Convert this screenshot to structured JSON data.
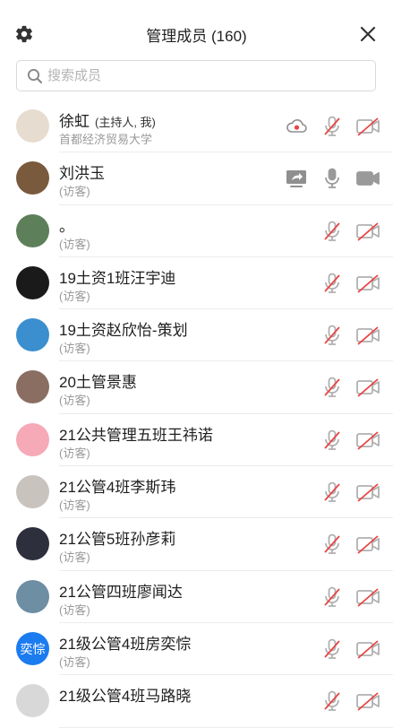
{
  "header": {
    "title": "管理成员 (160)"
  },
  "search": {
    "placeholder": "搜索成员"
  },
  "members": [
    {
      "name": "徐虹",
      "role": "(主持人, 我)",
      "org": "首都经济贸易大学",
      "avatar_color": "#e7dcd0",
      "avatar_text": "",
      "status_icon": "cloud-icon",
      "mic": "muted",
      "video": "off"
    },
    {
      "name": "刘洪玉",
      "role": "",
      "org": "(访客)",
      "avatar_color": "#7a5a3c",
      "avatar_text": "",
      "status_icon": "screen-share-icon",
      "mic": "on",
      "video": "on"
    },
    {
      "name": "。",
      "role": "",
      "org": "(访客)",
      "avatar_color": "#5d7f5a",
      "avatar_text": "",
      "status_icon": "",
      "mic": "muted",
      "video": "off"
    },
    {
      "name": "19土资1班汪宇迪",
      "role": "",
      "org": "(访客)",
      "avatar_color": "#1a1a1a",
      "avatar_text": "",
      "status_icon": "",
      "mic": "muted",
      "video": "off"
    },
    {
      "name": "19土资赵欣怡-策划",
      "role": "",
      "org": "(访客)",
      "avatar_color": "#3b8fcf",
      "avatar_text": "",
      "status_icon": "",
      "mic": "muted",
      "video": "off"
    },
    {
      "name": "20土管景惠",
      "role": "",
      "org": "(访客)",
      "avatar_color": "#8a6e62",
      "avatar_text": "",
      "status_icon": "",
      "mic": "muted",
      "video": "off"
    },
    {
      "name": "21公共管理五班王祎诺",
      "role": "",
      "org": "(访客)",
      "avatar_color": "#f6a9b7",
      "avatar_text": "",
      "status_icon": "",
      "mic": "muted",
      "video": "off"
    },
    {
      "name": "21公管4班李斯玮",
      "role": "",
      "org": "(访客)",
      "avatar_color": "#c9c3bd",
      "avatar_text": "",
      "status_icon": "",
      "mic": "muted",
      "video": "off"
    },
    {
      "name": "21公管5班孙彦莉",
      "role": "",
      "org": "(访客)",
      "avatar_color": "#2e2f3d",
      "avatar_text": "",
      "status_icon": "",
      "mic": "muted",
      "video": "off"
    },
    {
      "name": "21公管四班廖闻达",
      "role": "",
      "org": "(访客)",
      "avatar_color": "#6d8ea3",
      "avatar_text": "",
      "status_icon": "",
      "mic": "muted",
      "video": "off"
    },
    {
      "name": "21级公管4班房奕悰",
      "role": "",
      "org": "(访客)",
      "avatar_color": "#1b7cf0",
      "avatar_text": "奕悰",
      "status_icon": "",
      "mic": "muted",
      "video": "off"
    },
    {
      "name": "21级公管4班马路晓",
      "role": "",
      "org": "",
      "avatar_color": "#d8d8d8",
      "avatar_text": "",
      "status_icon": "",
      "mic": "muted",
      "video": "off"
    }
  ],
  "colors": {
    "muted_red": "#e84545",
    "icon_gray": "#9a9a9a",
    "divider": "#ececec"
  }
}
